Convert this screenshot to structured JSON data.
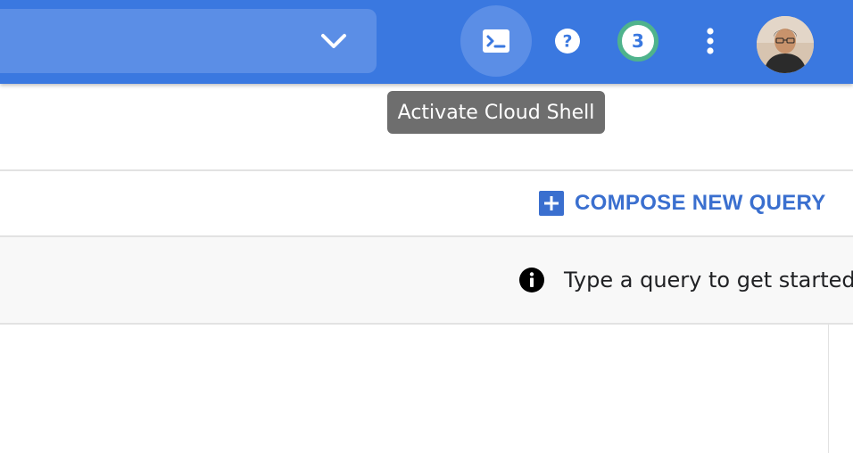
{
  "header": {
    "tooltip": "Activate Cloud Shell",
    "notification_count": "3",
    "colors": {
      "bar": "#3a78e0",
      "notif_ring": "#4fb38c"
    }
  },
  "toolbar": {
    "compose_label": "COMPOSE NEW QUERY"
  },
  "hint": {
    "text": "Type a query to get started"
  },
  "icons": {
    "dropdown": "chevron-down-icon",
    "shell": "cloud-shell-terminal-icon",
    "help": "help-icon",
    "notifications": "notifications-badge",
    "more": "more-vert-icon",
    "compose": "plus-box-icon",
    "info": "info-icon"
  }
}
